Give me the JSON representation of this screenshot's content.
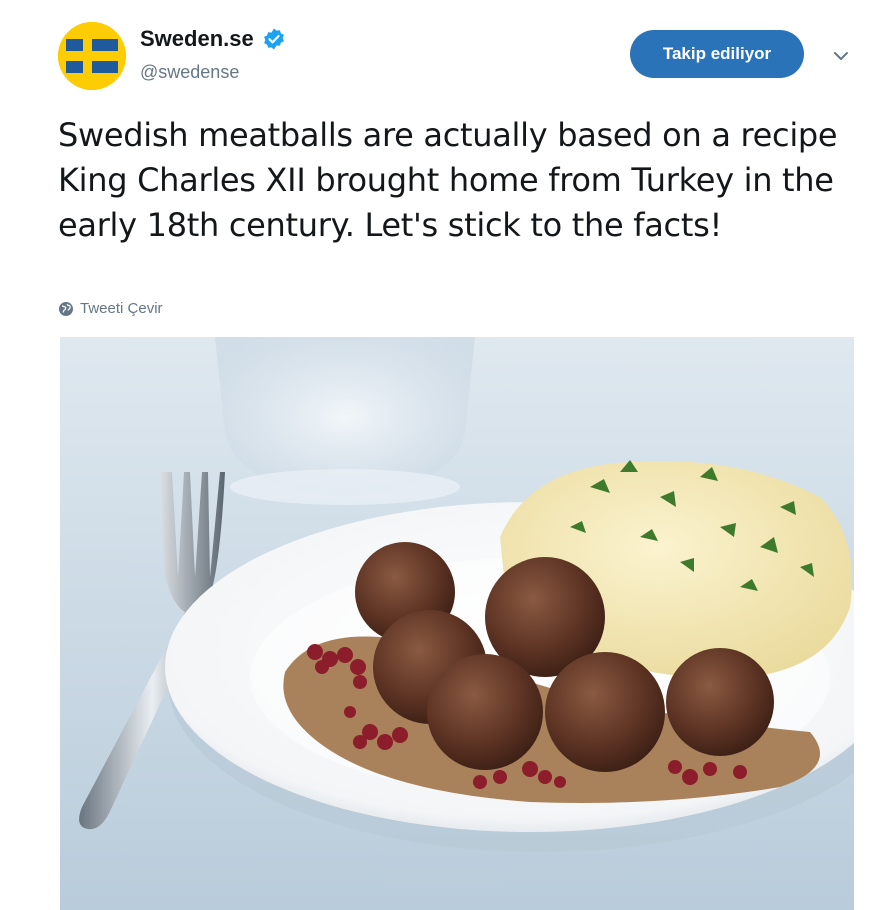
{
  "account": {
    "display_name": "Sweden.se",
    "handle": "@swedense",
    "verified": true,
    "avatar_icon": "sweden-flag-icon",
    "flag_colors": {
      "blue": "#1e5a9c",
      "yellow": "#fecc02"
    }
  },
  "follow_button": {
    "label": "Takip ediliyor",
    "color": "#2a73b9"
  },
  "menu": {
    "icon": "chevron-down-icon"
  },
  "tweet": {
    "text": "Swedish meatballs are actually based on a recipe King Charles XII brought home from Turkey in the early 18th century. Let's stick to the facts!",
    "translate_label": "Tweeti Çevir",
    "translate_icon": "globe-icon"
  },
  "media": {
    "icon": "photo-meatballs-plate"
  }
}
